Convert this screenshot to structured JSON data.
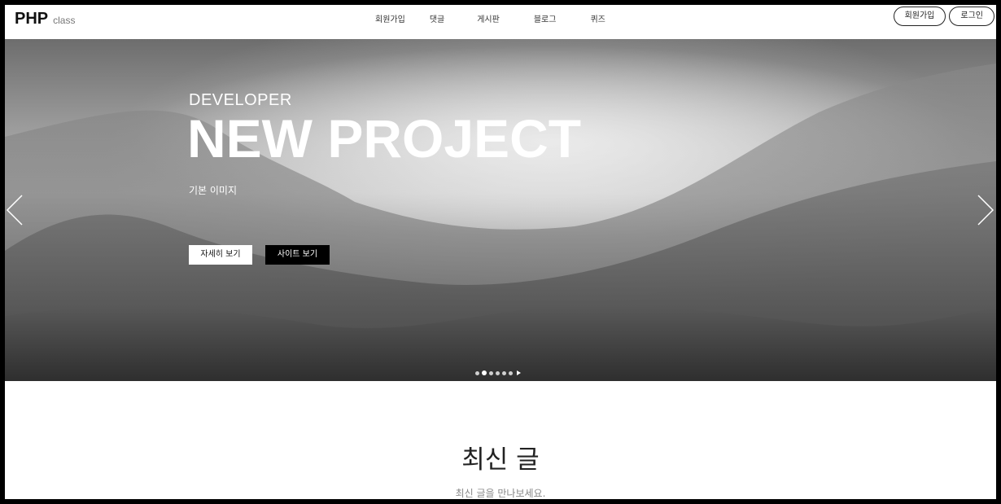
{
  "header": {
    "logo_main": "PHP",
    "logo_sub": "class",
    "nav": [
      "회원가입",
      "댓글",
      "게시판",
      "블로그",
      "퀴즈"
    ],
    "auth": {
      "signup": "회원가입",
      "login": "로그인"
    }
  },
  "hero": {
    "subtitle": "DEVELOPER",
    "title": "NEW PROJECT",
    "description": "기본 이미지",
    "buttons": {
      "detail": "자세히 보기",
      "site": "사이트 보기"
    },
    "slides_count": 6,
    "active_slide": 2
  },
  "section": {
    "title": "최신 글",
    "subtitle": "최신 글을 만나보세요."
  },
  "colors": {
    "frame": "#000000",
    "background": "#ffffff",
    "button_dark": "#000000",
    "text_dark": "#222222"
  }
}
